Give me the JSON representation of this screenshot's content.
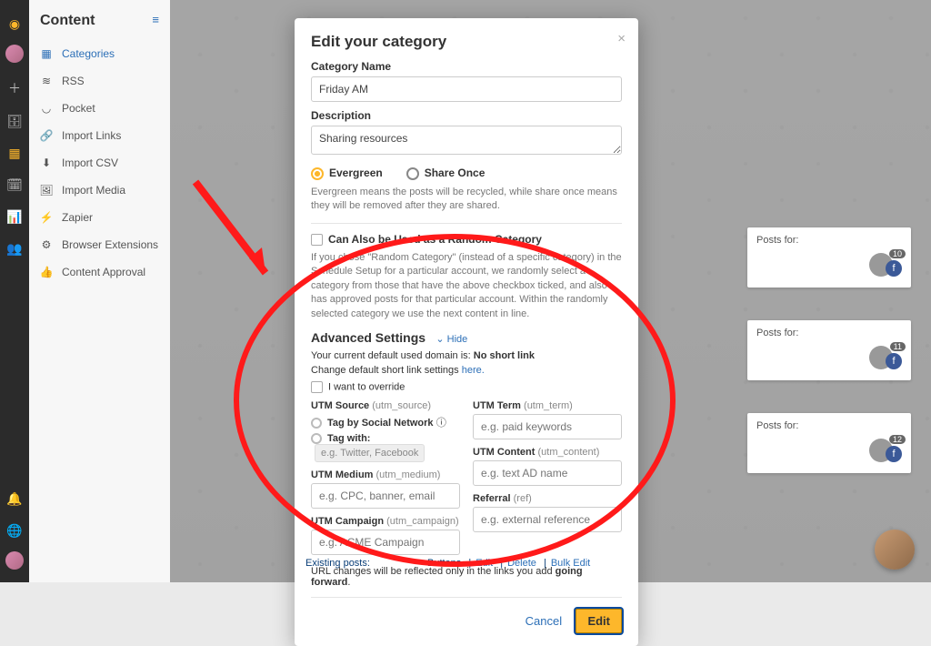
{
  "sidebar": {
    "title": "Content",
    "items": [
      {
        "label": "Categories"
      },
      {
        "label": "RSS"
      },
      {
        "label": "Pocket"
      },
      {
        "label": "Import Links"
      },
      {
        "label": "Import CSV"
      },
      {
        "label": "Import Media"
      },
      {
        "label": "Zapier"
      },
      {
        "label": "Browser Extensions"
      },
      {
        "label": "Content Approval"
      }
    ]
  },
  "cards": [
    {
      "title": "Posts for:",
      "count": "10"
    },
    {
      "title": "Posts for:",
      "count": "11"
    },
    {
      "title": "Posts for:",
      "count": "12"
    }
  ],
  "existing_bar": {
    "prefix": "Existing posts:",
    "buttons": "Buttons",
    "edit": "Edit",
    "delete": "Delete",
    "bulk": "Bulk Edit"
  },
  "modal": {
    "title": "Edit your category",
    "cat_name_label": "Category Name",
    "cat_name_value": "Friday AM",
    "desc_label": "Description",
    "desc_value": "Sharing resources",
    "share_evergreen": "Evergreen",
    "share_once": "Share Once",
    "share_help": "Evergreen means the posts will be recycled, while share once means they will be removed after they are shared.",
    "random_label": "Can Also be Used as a Random Category",
    "random_help": "If you chose \"Random Category\" (instead of a specific category) in the Schedule Setup for a particular account, we randomly select a category from those that have the above checkbox ticked, and also has approved posts for that particular account. Within the randomly selected category we use the next content in line.",
    "adv_title": "Advanced Settings",
    "adv_toggle": "Hide",
    "domain_prefix": "Your current default used domain is: ",
    "domain_bold": "No short link",
    "change_prefix": "Change default short link settings ",
    "change_link": "here.",
    "override": "I want to override",
    "utm_source_label": "UTM Source",
    "utm_source_g": "(utm_source)",
    "tag_social": "Tag by Social Network",
    "tag_with": "Tag with:",
    "tag_with_ph": "e.g. Twitter, Facebook",
    "utm_medium_label": "UTM Medium",
    "utm_medium_g": "(utm_medium)",
    "utm_medium_ph": "e.g. CPC, banner, email",
    "utm_campaign_label": "UTM Campaign",
    "utm_campaign_g": "(utm_campaign)",
    "utm_campaign_ph": "e.g. ACME Campaign",
    "utm_term_label": "UTM Term",
    "utm_term_g": "(utm_term)",
    "utm_term_ph": "e.g. paid keywords",
    "utm_content_label": "UTM Content",
    "utm_content_g": "(utm_content)",
    "utm_content_ph": "e.g. text AD name",
    "referral_label": "Referral",
    "referral_g": "(ref)",
    "referral_ph": "e.g. external reference",
    "url_note_pre": "URL changes will be reflected only in the links you add ",
    "url_note_bold": "going forward",
    "cancel": "Cancel",
    "edit": "Edit"
  }
}
